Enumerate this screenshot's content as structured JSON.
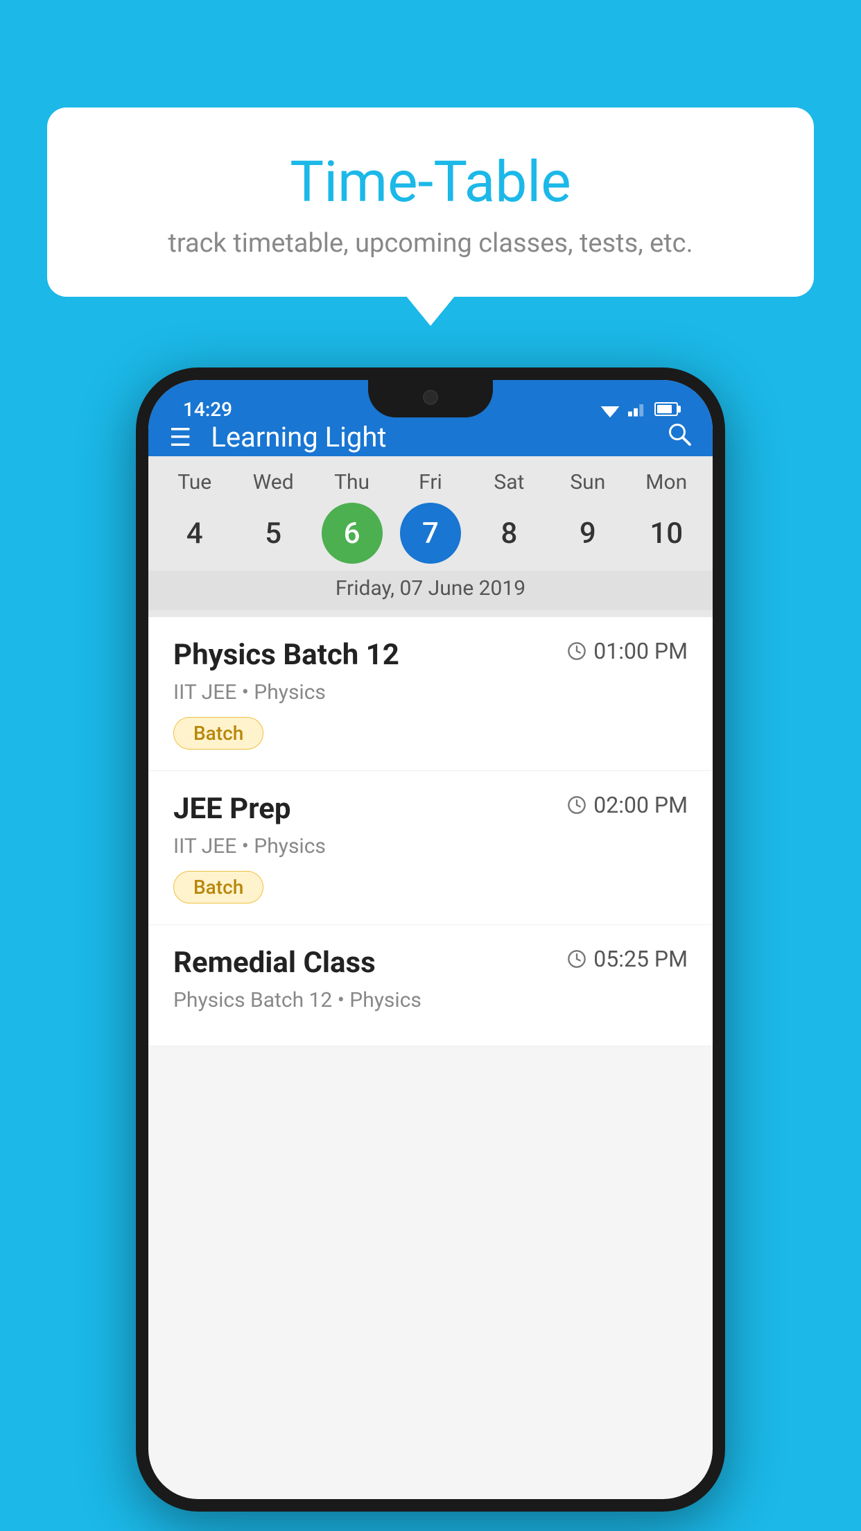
{
  "background_color": "#1BB8E8",
  "speech_bubble": {
    "title": "Time-Table",
    "subtitle": "track timetable, upcoming classes, tests, etc."
  },
  "phone": {
    "status_bar": {
      "time": "14:29"
    },
    "app_bar": {
      "title": "Learning Light",
      "hamburger_label": "☰",
      "search_label": "🔍"
    },
    "calendar": {
      "days": [
        "Tue",
        "Wed",
        "Thu",
        "Fri",
        "Sat",
        "Sun",
        "Mon"
      ],
      "dates": [
        {
          "day": "4",
          "state": "normal"
        },
        {
          "day": "5",
          "state": "normal"
        },
        {
          "day": "6",
          "state": "today"
        },
        {
          "day": "7",
          "state": "selected"
        },
        {
          "day": "8",
          "state": "normal"
        },
        {
          "day": "9",
          "state": "normal"
        },
        {
          "day": "10",
          "state": "normal"
        }
      ],
      "selected_date_label": "Friday, 07 June 2019"
    },
    "schedule": [
      {
        "name": "Physics Batch 12",
        "time": "01:00 PM",
        "meta": "IIT JEE • Physics",
        "tag": "Batch"
      },
      {
        "name": "JEE Prep",
        "time": "02:00 PM",
        "meta": "IIT JEE • Physics",
        "tag": "Batch"
      },
      {
        "name": "Remedial Class",
        "time": "05:25 PM",
        "meta": "Physics Batch 12 • Physics",
        "tag": ""
      }
    ]
  }
}
